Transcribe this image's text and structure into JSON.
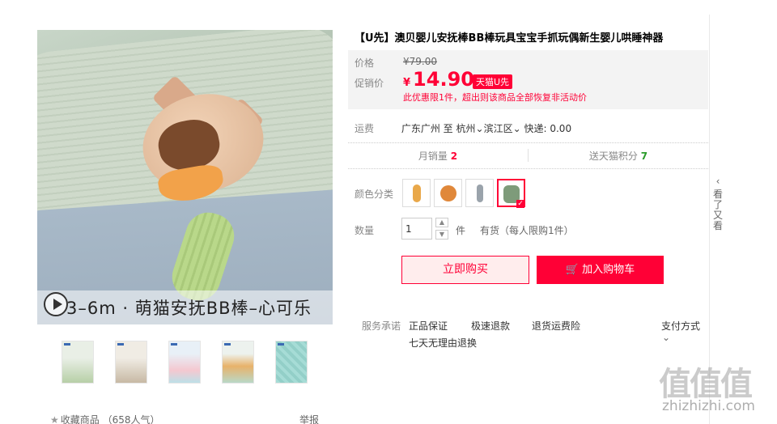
{
  "product": {
    "title": "【U先】澳贝婴儿安抚棒BB棒玩具宝宝手抓玩偶新生婴儿哄睡神器",
    "image_caption": "3–6m · 萌猫安抚BB棒–心可乐"
  },
  "price": {
    "price_label": "价格",
    "original_price": "¥79.00",
    "promo_label": "促销价",
    "currency": "¥",
    "promo_price": "14.90",
    "tag": "天猫U先",
    "note": "此优惠限1件，超出则该商品全部恢复非活动价"
  },
  "shipping": {
    "label": "运费",
    "from": "广东广州",
    "to_word": "至",
    "city": "杭州",
    "district": "滨江区",
    "express": "快递: 0.00"
  },
  "stats": {
    "monthly_label": "月销量",
    "monthly_value": "2",
    "points_label": "送天猫积分",
    "points_value": "7"
  },
  "options": {
    "color_label": "颜色分类",
    "swatch_colors": [
      "#e9a84a",
      "#e0883a",
      "#9aa3ab",
      "#7e9b7a"
    ],
    "selected_index": 3,
    "qty_label": "数量",
    "qty_value": "1",
    "qty_unit": "件",
    "stock": "有货（每人限购1件）"
  },
  "actions": {
    "buy_now": "立即购买",
    "add_to_cart": "加入购物车"
  },
  "service": {
    "label": "服务承诺",
    "items": [
      "正品保证",
      "极速退款",
      "退货运费险"
    ],
    "line2": "七天无理由退换",
    "pay_label": "支付方式"
  },
  "gallery": {
    "favorite": "收藏商品",
    "popularity": "（658人气）",
    "report": "举报"
  },
  "rail": {
    "label": "看了又看"
  },
  "watermark": {
    "logo": "值值值",
    "site": "zhizhizhi.com"
  }
}
